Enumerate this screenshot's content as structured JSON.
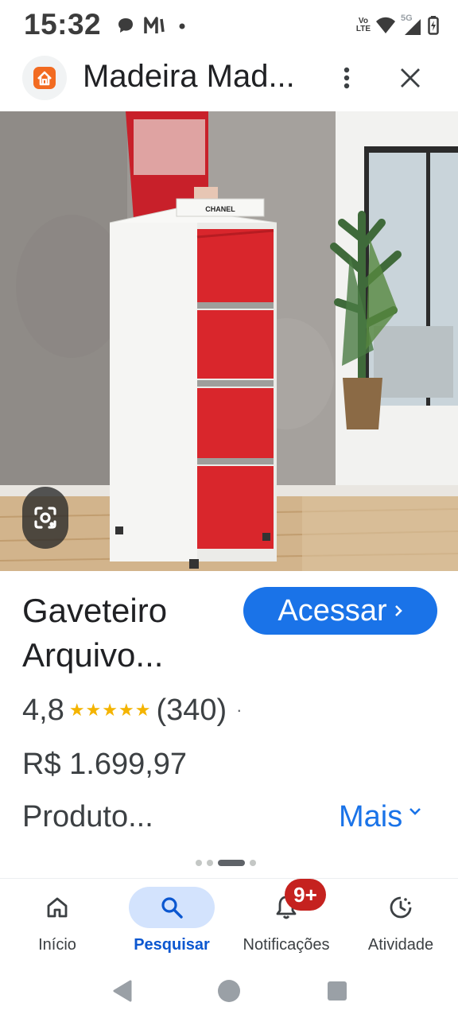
{
  "status_bar": {
    "time": "15:32",
    "icons": [
      "chat-bubble-icon",
      "music-m-icon",
      "dot-icon",
      "volte-icon",
      "wifi-icon",
      "5g-signal-icon",
      "battery-icon"
    ],
    "volte_top": "Vo",
    "volte_bottom": "LTE",
    "network": "5G"
  },
  "header": {
    "site_title": "Madeira Mad...",
    "logo_color": "#f26b21",
    "menu_icon": "kebab-menu-icon",
    "close_icon": "close-icon"
  },
  "image": {
    "product_label": "CHANEL",
    "lens_icon": "google-lens-icon",
    "cabinet_color": "#d9262c"
  },
  "product": {
    "title_line1": "Gaveteiro",
    "title_line2": "Arquivo...",
    "access_label": "Acessar",
    "rating": "4,8",
    "stars": "★★★★★",
    "reviews": "(340)",
    "separator": "·",
    "price": "R$ 1.699,97",
    "description": "Produto...",
    "more_label": "Mais"
  },
  "pager": {
    "count": 4,
    "active": 2
  },
  "bottom_nav": {
    "items": [
      {
        "label": "Início",
        "icon": "home-icon"
      },
      {
        "label": "Pesquisar",
        "icon": "search-icon"
      },
      {
        "label": "Notificações",
        "icon": "bell-icon"
      },
      {
        "label": "Atividade",
        "icon": "activity-icon"
      }
    ],
    "active_index": 1,
    "notification_badge": "9+"
  },
  "system_nav": {
    "icons": [
      "back-icon",
      "home-circle-icon",
      "recents-icon"
    ]
  },
  "colors": {
    "accent": "#1a73e8",
    "active_pill": "#d3e3fd",
    "badge": "#c5221f",
    "star": "#f4b400"
  }
}
